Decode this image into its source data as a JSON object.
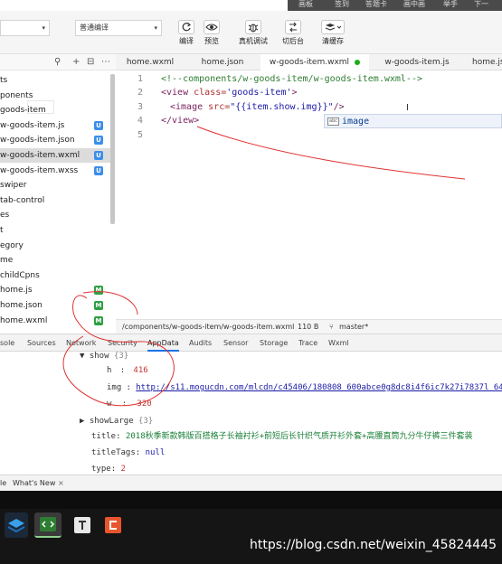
{
  "top_menu": [
    "画板",
    "签到",
    "答题卡",
    "画中画",
    "举手",
    "下一"
  ],
  "toolbar": {
    "mode_select": "",
    "compile_select": "普通编译",
    "buttons": [
      {
        "label": "编译",
        "icon": "refresh-icon"
      },
      {
        "label": "预览",
        "icon": "eye-icon"
      },
      {
        "label": "真机调试",
        "icon": "bug-icon"
      },
      {
        "label": "切后台",
        "icon": "switch-icon"
      },
      {
        "label": "清缓存",
        "icon": "layers-icon"
      }
    ]
  },
  "tree": {
    "items": [
      {
        "label": "ts",
        "badge": ""
      },
      {
        "label": "ponents",
        "badge": ""
      },
      {
        "label": "goods-item",
        "badge": ""
      },
      {
        "label": "w-goods-item.js",
        "badge": "U"
      },
      {
        "label": "w-goods-item.json",
        "badge": "U"
      },
      {
        "label": "w-goods-item.wxml",
        "badge": "U",
        "selected": true
      },
      {
        "label": "w-goods-item.wxss",
        "badge": "U"
      },
      {
        "label": "swiper",
        "badge": ""
      },
      {
        "label": "tab-control",
        "badge": ""
      },
      {
        "label": "es",
        "badge": ""
      },
      {
        "label": "t",
        "badge": ""
      },
      {
        "label": "egory",
        "badge": ""
      },
      {
        "label": "me",
        "badge": ""
      },
      {
        "label": "childCpns",
        "badge": ""
      },
      {
        "label": "home.js",
        "badge": "M"
      },
      {
        "label": "home.json",
        "badge": "M"
      },
      {
        "label": "home.wxml",
        "badge": "M"
      }
    ],
    "badge_colors": {
      "U": "#3b8eea",
      "M": "#2ea043"
    }
  },
  "tabs": [
    {
      "label": "home.wxml"
    },
    {
      "label": "home.json"
    },
    {
      "label": "w-goods-item.wxml",
      "active": true
    },
    {
      "label": "w-goods-item.js"
    },
    {
      "label": "home.js"
    }
  ],
  "editor": {
    "line_numbers": [
      "1",
      "2",
      "3",
      "4",
      "5"
    ],
    "line1": "<!--components/w-goods-item/w-goods-item.wxml-->",
    "line2_tag": "<view ",
    "line2_attr": "class=",
    "line2_str": "'goods-item'",
    "line2_end": ">",
    "line3_tag": "<image ",
    "line3_attr": "src=",
    "line3_str": "\"{{item.show.img}}\"",
    "line3_end": "/>",
    "line4": "</view>",
    "suggestion_kind": "abc",
    "suggestion": "image"
  },
  "statusbar": {
    "path": "/components/w-goods-item/w-goods-item.wxml",
    "size": "110 B",
    "branch": "master*"
  },
  "devtools_tabs": [
    "sole",
    "Sources",
    "Network",
    "Security",
    "AppData",
    "Audits",
    "Sensor",
    "Storage",
    "Trace",
    "Wxml"
  ],
  "appdata": {
    "show_key": "show",
    "show_meta": "{3}",
    "h_key": "h",
    "h_val": "416",
    "img_key": "img",
    "img_val": "http://s11.mogucdn.com/mlcdn/c45406/180808_600abce0g8dc8i4f6ic7k27i7837l_640x960.jpg",
    "w_key": "w",
    "w_val": "320",
    "showLarge_key": "showLarge",
    "showLarge_meta": "{3}",
    "title_key": "title",
    "title_val": "2018秋季新款韩版百搭格子长袖衬衫+前短后长针织气质开衫外套+高腰直筒九分牛仔裤三件套装",
    "titleTags_key": "titleTags",
    "titleTags_val": "null",
    "type_key": "type",
    "type_val": "2"
  },
  "drawer_tabs": [
    "le",
    "What's New"
  ],
  "watermark": "https://blog.csdn.net/weixin_45824445",
  "colors": {
    "accent": "#1aad19",
    "annotation": "#e03030"
  }
}
